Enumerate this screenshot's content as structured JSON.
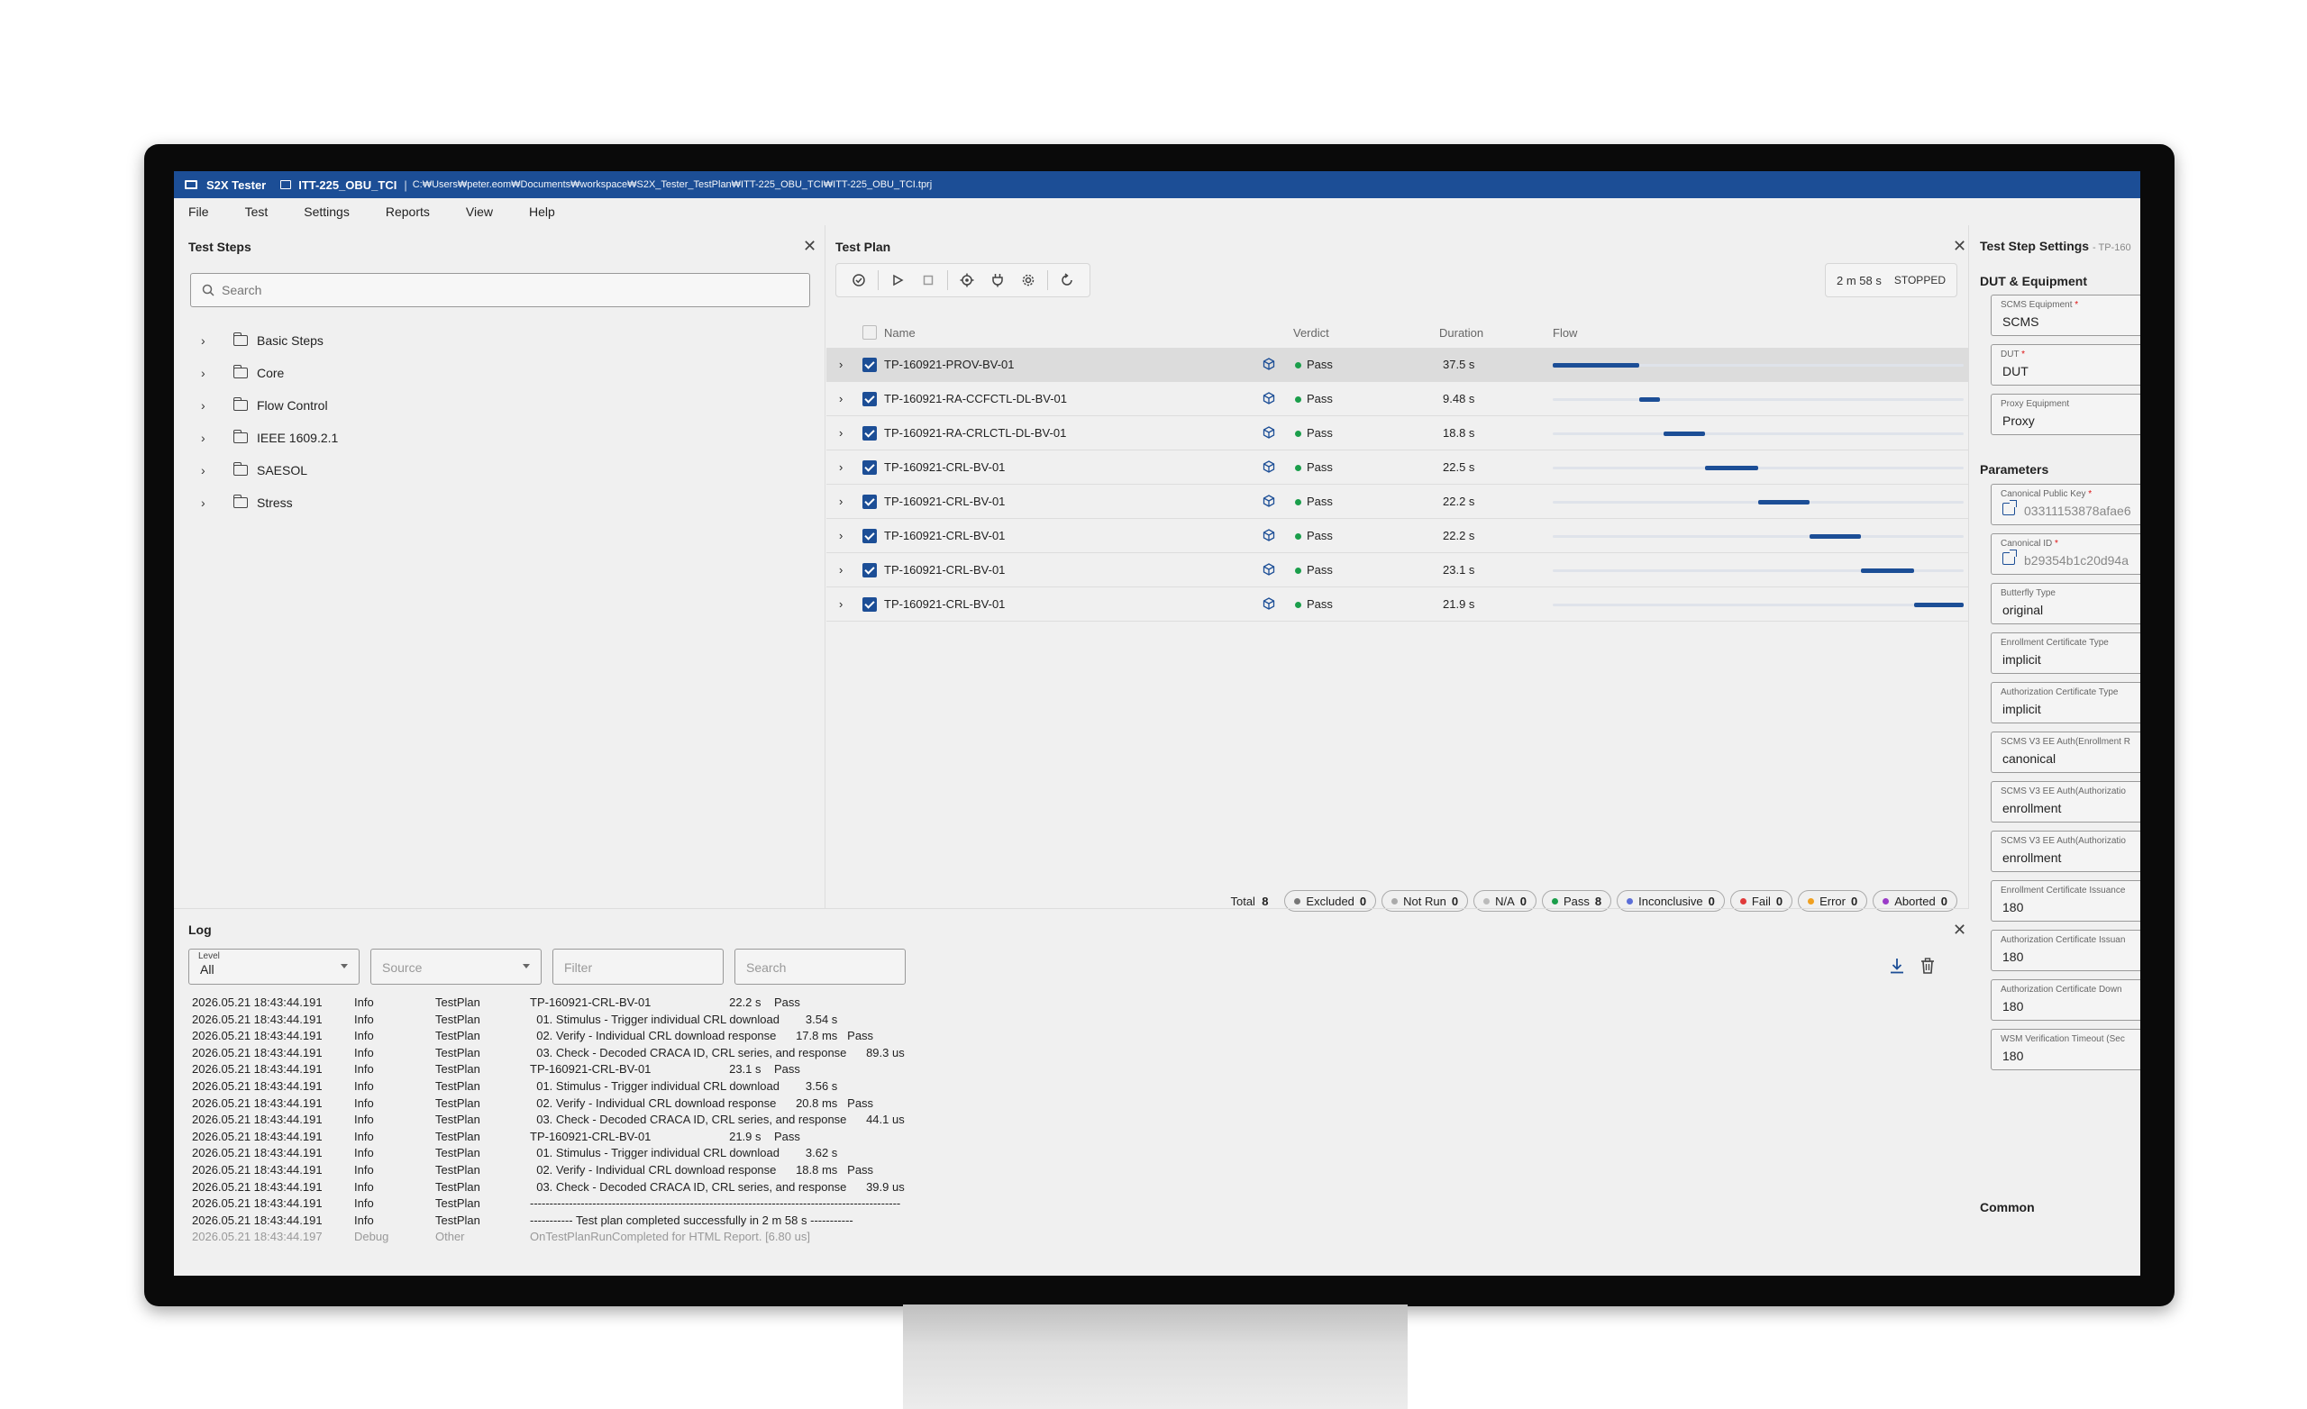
{
  "title": {
    "app": "S2X Tester",
    "project": "ITT-225_OBU_TCI",
    "path": "C:₩Users₩peter.eom₩Documents₩workspace₩S2X_Tester_TestPlan₩ITT-225_OBU_TCI₩ITT-225_OBU_TCI.tprj"
  },
  "menu": [
    "File",
    "Test",
    "Settings",
    "Reports",
    "View",
    "Help"
  ],
  "steps": {
    "title": "Test Steps",
    "search_placeholder": "Search",
    "folders": [
      "Basic Steps",
      "Core",
      "Flow Control",
      "IEEE 1609.2.1",
      "SAESOL",
      "Stress"
    ]
  },
  "plan": {
    "title": "Test Plan",
    "elapsed": "2 m 58 s",
    "state": "STOPPED",
    "columns": {
      "name": "Name",
      "verdict": "Verdict",
      "duration": "Duration",
      "flow": "Flow"
    },
    "rows": [
      {
        "name": "TP-160921-PROV-BV-01",
        "verdict": "Pass",
        "duration": "37.5 s",
        "flow_start": 0.0,
        "flow_end": 0.21
      },
      {
        "name": "TP-160921-RA-CCFCTL-DL-BV-01",
        "verdict": "Pass",
        "duration": "9.48 s",
        "flow_start": 0.21,
        "flow_end": 0.26
      },
      {
        "name": "TP-160921-RA-CRLCTL-DL-BV-01",
        "verdict": "Pass",
        "duration": "18.8 s",
        "flow_start": 0.27,
        "flow_end": 0.37
      },
      {
        "name": "TP-160921-CRL-BV-01",
        "verdict": "Pass",
        "duration": "22.5 s",
        "flow_start": 0.37,
        "flow_end": 0.5
      },
      {
        "name": "TP-160921-CRL-BV-01",
        "verdict": "Pass",
        "duration": "22.2 s",
        "flow_start": 0.5,
        "flow_end": 0.625
      },
      {
        "name": "TP-160921-CRL-BV-01",
        "verdict": "Pass",
        "duration": "22.2 s",
        "flow_start": 0.625,
        "flow_end": 0.75
      },
      {
        "name": "TP-160921-CRL-BV-01",
        "verdict": "Pass",
        "duration": "23.1 s",
        "flow_start": 0.75,
        "flow_end": 0.88
      },
      {
        "name": "TP-160921-CRL-BV-01",
        "verdict": "Pass",
        "duration": "21.9 s",
        "flow_start": 0.88,
        "flow_end": 1.0
      }
    ],
    "summary": {
      "total_label": "Total",
      "total": "8",
      "pills": [
        {
          "label": "Excluded",
          "count": "0",
          "color": "#777777"
        },
        {
          "label": "Not Run",
          "count": "0",
          "color": "#aaaaaa"
        },
        {
          "label": "N/A",
          "count": "0",
          "color": "#bbbbbb"
        },
        {
          "label": "Pass",
          "count": "8",
          "color": "#1b9e4b"
        },
        {
          "label": "Inconclusive",
          "count": "0",
          "color": "#5b6ed8"
        },
        {
          "label": "Fail",
          "count": "0",
          "color": "#e03a3a"
        },
        {
          "label": "Error",
          "count": "0",
          "color": "#f0a020"
        },
        {
          "label": "Aborted",
          "count": "0",
          "color": "#9a3bc8"
        }
      ]
    }
  },
  "settings": {
    "title": "Test Step Settings",
    "subtitle": "- TP-160",
    "dut_section": "DUT & Equipment",
    "params_section": "Parameters",
    "common_section": "Common",
    "dut_fields": [
      {
        "label": "SCMS Equipment",
        "required": true,
        "value": "SCMS"
      },
      {
        "label": "DUT",
        "required": true,
        "value": "DUT"
      },
      {
        "label": "Proxy Equipment",
        "required": false,
        "value": "Proxy"
      }
    ],
    "param_fields": [
      {
        "label": "Canonical Public Key",
        "required": true,
        "value": "03311153878afae6",
        "link": true
      },
      {
        "label": "Canonical ID",
        "required": true,
        "value": "b29354b1c20d94a",
        "link": true
      },
      {
        "label": "Butterfly Type",
        "required": false,
        "value": "original"
      },
      {
        "label": "Enrollment Certificate Type",
        "required": false,
        "value": "implicit"
      },
      {
        "label": "Authorization Certificate Type",
        "required": false,
        "value": "implicit"
      },
      {
        "label": "SCMS V3 EE Auth(Enrollment R",
        "required": false,
        "value": "canonical"
      },
      {
        "label": "SCMS V3 EE Auth(Authorizatio",
        "required": false,
        "value": "enrollment"
      },
      {
        "label": "SCMS V3 EE Auth(Authorizatio",
        "required": false,
        "value": "enrollment"
      },
      {
        "label": "Enrollment Certificate Issuance",
        "required": false,
        "value": "180"
      },
      {
        "label": "Authorization Certificate Issuan",
        "required": false,
        "value": "180"
      },
      {
        "label": "Authorization Certificate Down",
        "required": false,
        "value": "180"
      },
      {
        "label": "WSM Verification Timeout (Sec",
        "required": false,
        "value": "180"
      }
    ]
  },
  "log": {
    "title": "Log",
    "level_label": "Level",
    "level_value": "All",
    "source_placeholder": "Source",
    "filter_placeholder": "Filter",
    "search_placeholder": "Search",
    "lines": [
      {
        "time": "2026.05.21 18:43:44.191",
        "level": "Info",
        "source": "TestPlan",
        "msg": "TP-160921-CRL-BV-01                        22.2 s    Pass"
      },
      {
        "time": "2026.05.21 18:43:44.191",
        "level": "Info",
        "source": "TestPlan",
        "msg": "  01. Stimulus - Trigger individual CRL download        3.54 s"
      },
      {
        "time": "2026.05.21 18:43:44.191",
        "level": "Info",
        "source": "TestPlan",
        "msg": "  02. Verify - Individual CRL download response      17.8 ms   Pass"
      },
      {
        "time": "2026.05.21 18:43:44.191",
        "level": "Info",
        "source": "TestPlan",
        "msg": "  03. Check - Decoded CRACA ID, CRL series, and response      89.3 us"
      },
      {
        "time": "2026.05.21 18:43:44.191",
        "level": "Info",
        "source": "TestPlan",
        "msg": "TP-160921-CRL-BV-01                        23.1 s    Pass"
      },
      {
        "time": "2026.05.21 18:43:44.191",
        "level": "Info",
        "source": "TestPlan",
        "msg": "  01. Stimulus - Trigger individual CRL download        3.56 s"
      },
      {
        "time": "2026.05.21 18:43:44.191",
        "level": "Info",
        "source": "TestPlan",
        "msg": "  02. Verify - Individual CRL download response      20.8 ms   Pass"
      },
      {
        "time": "2026.05.21 18:43:44.191",
        "level": "Info",
        "source": "TestPlan",
        "msg": "  03. Check - Decoded CRACA ID, CRL series, and response      44.1 us"
      },
      {
        "time": "2026.05.21 18:43:44.191",
        "level": "Info",
        "source": "TestPlan",
        "msg": "TP-160921-CRL-BV-01                        21.9 s    Pass"
      },
      {
        "time": "2026.05.21 18:43:44.191",
        "level": "Info",
        "source": "TestPlan",
        "msg": "  01. Stimulus - Trigger individual CRL download        3.62 s"
      },
      {
        "time": "2026.05.21 18:43:44.191",
        "level": "Info",
        "source": "TestPlan",
        "msg": "  02. Verify - Individual CRL download response      18.8 ms   Pass"
      },
      {
        "time": "2026.05.21 18:43:44.191",
        "level": "Info",
        "source": "TestPlan",
        "msg": "  03. Check - Decoded CRACA ID, CRL series, and response      39.9 us"
      },
      {
        "time": "2026.05.21 18:43:44.191",
        "level": "Info",
        "source": "TestPlan",
        "msg": "-----------------------------------------------------------------------------------------------"
      },
      {
        "time": "2026.05.21 18:43:44.191",
        "level": "Info",
        "source": "TestPlan",
        "msg": "----------- Test plan completed successfully in 2 m 58 s -----------"
      },
      {
        "time": "2026.05.21 18:43:44.197",
        "level": "Debug",
        "source": "Other",
        "msg": "OnTestPlanRunCompleted for HTML Report. [6.80 us]"
      }
    ]
  }
}
